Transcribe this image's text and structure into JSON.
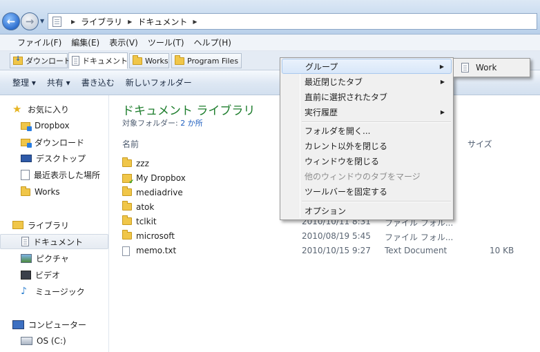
{
  "address": {
    "crumbs": [
      "ライブラリ",
      "ドキュメント"
    ]
  },
  "menubar": [
    "ファイル(F)",
    "編集(E)",
    "表示(V)",
    "ツール(T)",
    "ヘルプ(H)"
  ],
  "tabs": [
    {
      "label": "ダウンロード",
      "icon": "download-folder-icon"
    },
    {
      "label": "ドキュメント",
      "icon": "document-library-icon",
      "active": true
    },
    {
      "label": "Works",
      "icon": "folder-icon"
    },
    {
      "label": "Program Files",
      "icon": "folder-icon"
    }
  ],
  "commands": [
    "整理 ▾",
    "共有 ▾",
    "書き込む",
    "新しいフォルダー"
  ],
  "nav": {
    "favorites_label": "お気に入り",
    "favorites": [
      "Dropbox",
      "ダウンロード",
      "デスクトップ",
      "最近表示した場所",
      "Works"
    ],
    "libraries_label": "ライブラリ",
    "libraries": [
      "ドキュメント",
      "ピクチャ",
      "ビデオ",
      "ミュージック"
    ],
    "computer_label": "コンピューター",
    "drives": [
      "OS (C:)"
    ]
  },
  "library": {
    "title": "ドキュメント ライブラリ",
    "target_prefix": "対象フォルダー: ",
    "target_link": "2 か所"
  },
  "columns": {
    "name": "名前",
    "size": "サイズ"
  },
  "files": [
    {
      "name": "zzz",
      "date": "",
      "type": "",
      "size": ""
    },
    {
      "name": "My Dropbox",
      "date": "",
      "type": "",
      "size": ""
    },
    {
      "name": "mediadrive",
      "date": "",
      "type": "",
      "size": ""
    },
    {
      "name": "atok",
      "date": "",
      "type": "",
      "size": ""
    },
    {
      "name": "tclkit",
      "date": "2010/10/11 8:31",
      "type": "ファイル フォル...",
      "size": ""
    },
    {
      "name": "microsoft",
      "date": "2010/08/19 5:45",
      "type": "ファイル フォル...",
      "size": ""
    },
    {
      "name": "memo.txt",
      "date": "2010/10/15 9:27",
      "type": "Text Document",
      "size": "10 KB"
    }
  ],
  "context_menu": {
    "items": [
      {
        "label": "グループ",
        "submenu": true
      },
      {
        "label": "最近閉じたタブ",
        "submenu": true
      },
      {
        "label": "直前に選択されたタブ"
      },
      {
        "label": "実行履歴",
        "submenu": true
      },
      {
        "label": "フォルダを開く..."
      },
      {
        "label": "カレント以外を閉じる"
      },
      {
        "label": "ウィンドウを閉じる"
      },
      {
        "label": "他のウィンドウのタブをマージ",
        "disabled": true
      },
      {
        "label": "ツールバーを固定する"
      },
      {
        "label": "オプション"
      }
    ],
    "submenu_item": "Work"
  }
}
